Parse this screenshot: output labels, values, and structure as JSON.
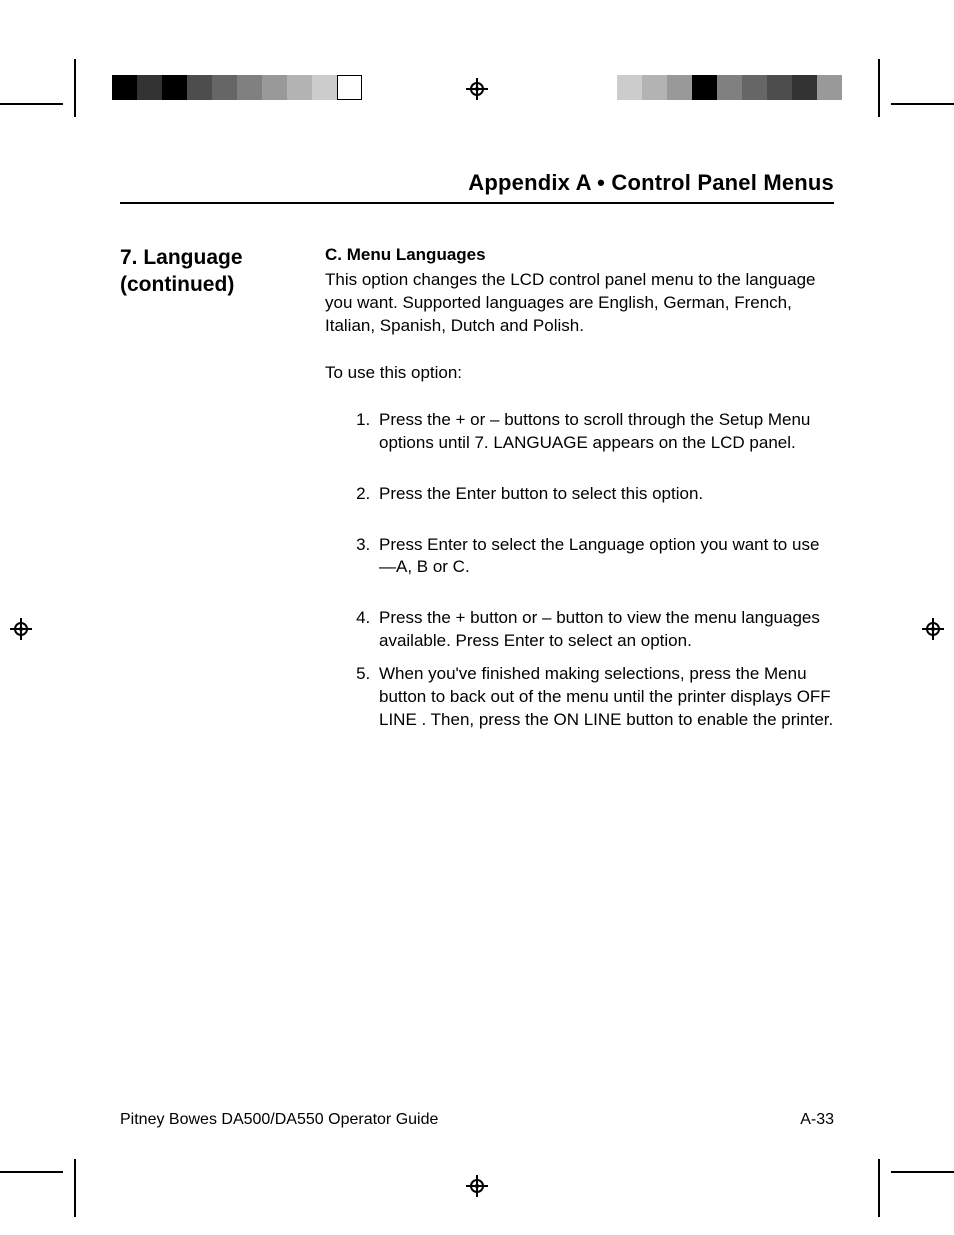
{
  "header": {
    "title": "Appendix A   •   Control Panel Menus"
  },
  "sidebar": {
    "line1": "7.  Language",
    "line2": "(continued)"
  },
  "section": {
    "subheading": "C.  Menu Languages",
    "intro": "This option changes the LCD control panel menu to the language you want. Supported languages are English, German, French, Italian, Spanish, Dutch and Polish.",
    "lead_in": "To use this option:",
    "steps": [
      "Press the + or – buttons to scroll through the Setup Menu options until 7. LANGUAGE appears on the LCD panel.",
      "Press the Enter button to select this option.",
      "Press Enter to select the Language option you want to use—A, B or C.",
      "Press the + button or – button to view the menu languages available.  Press Enter to select an option.",
      "When you've finished making selections, press the Menu button to back out of the menu until the printer displays OFF LINE . Then, press the ON LINE button to enable the printer."
    ]
  },
  "footer": {
    "left": "Pitney Bowes DA500/DA550 Operator Guide",
    "right": "A-33"
  },
  "colorbar_left": [
    "#000000",
    "#333333",
    "#000000",
    "#4d4d4d",
    "#666666",
    "#808080",
    "#999999",
    "#b3b3b3",
    "#cccccc"
  ],
  "colorbar_right": [
    "#cccccc",
    "#b3b3b3",
    "#999999",
    "#000000",
    "#808080",
    "#666666",
    "#4d4d4d",
    "#333333",
    "#999999"
  ]
}
